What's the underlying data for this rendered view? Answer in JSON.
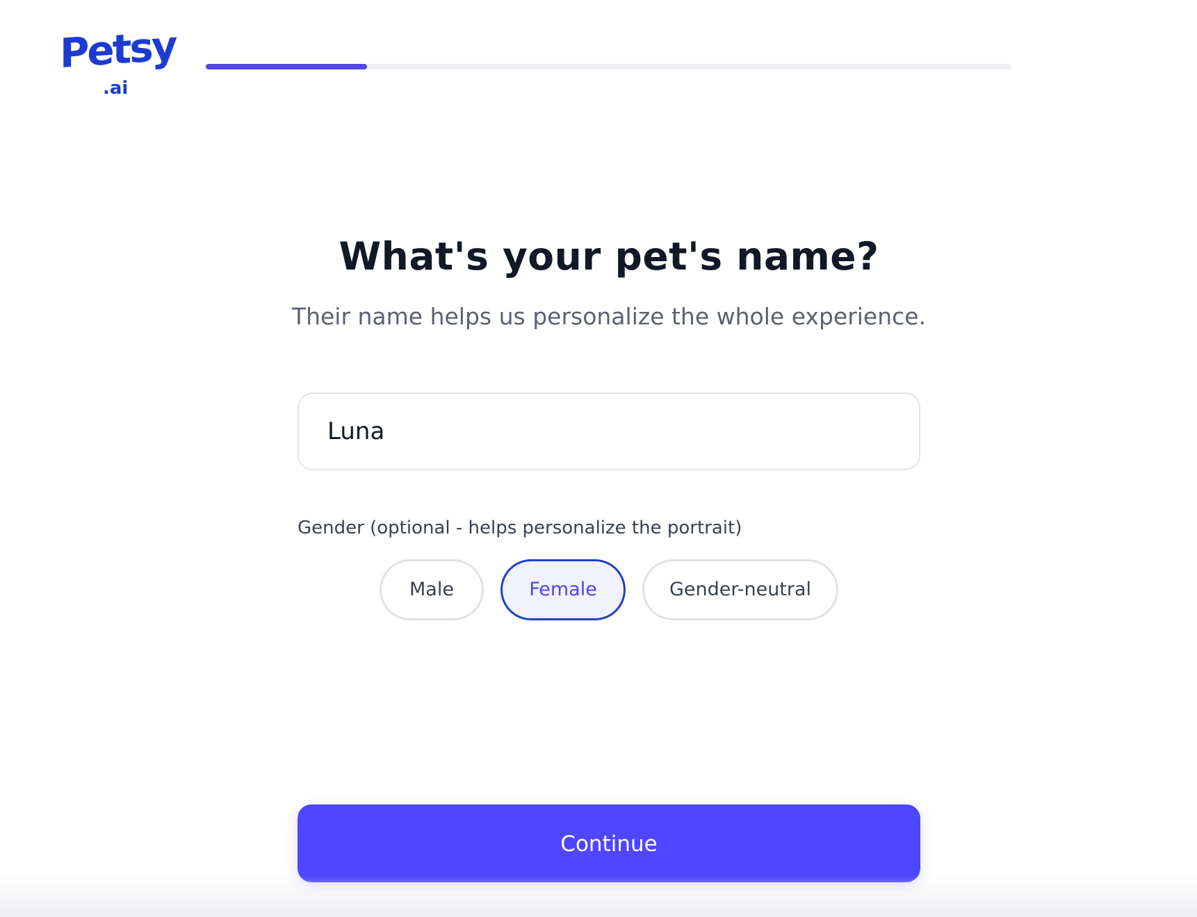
{
  "brand": {
    "logo_main": "Petsy",
    "logo_sub": ".ai",
    "logo_color": "#1d3bd1"
  },
  "progress": {
    "value_fraction": 0.2,
    "fill_color": "#4f46e5",
    "track_color": "#f0f0f5"
  },
  "main": {
    "title": "What's your pet's name?",
    "subtitle": "Their name helps us personalize the whole experience.",
    "name_input": {
      "value": "Luna"
    },
    "gender": {
      "label": "Gender (optional - helps personalize the portrait)",
      "options": [
        {
          "label": "Male",
          "selected": false
        },
        {
          "label": "Female",
          "selected": true
        },
        {
          "label": "Gender-neutral",
          "selected": false
        }
      ]
    },
    "continue_label": "Continue"
  },
  "colors": {
    "primary": "#4f46ff",
    "selected_border": "#1e40c8",
    "selected_bg": "#f2f2fd",
    "title": "#121826",
    "subtitle": "#5b6172"
  }
}
